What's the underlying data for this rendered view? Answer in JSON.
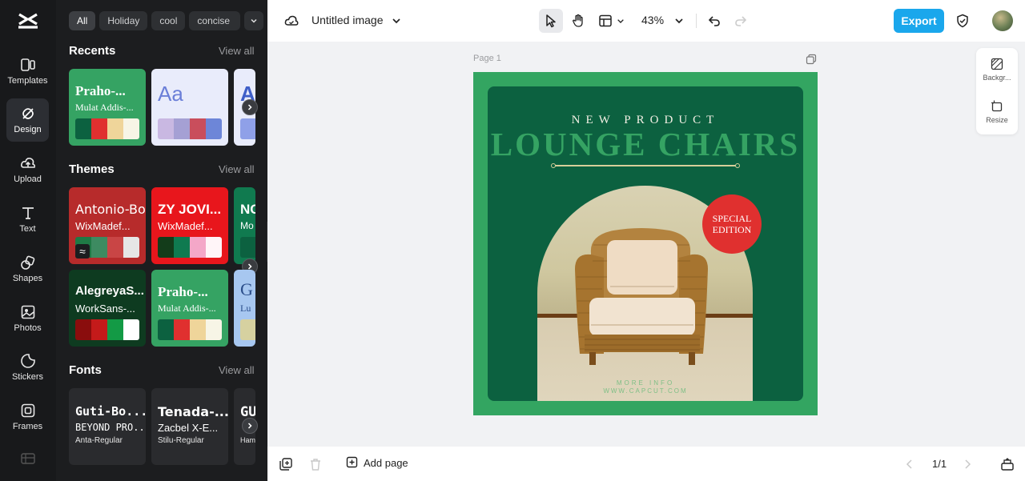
{
  "rail": {
    "items": [
      {
        "label": "Templates",
        "icon": "templates-icon"
      },
      {
        "label": "Design",
        "icon": "design-icon",
        "active": true
      },
      {
        "label": "Upload",
        "icon": "upload-icon"
      },
      {
        "label": "Text",
        "icon": "text-icon"
      },
      {
        "label": "Shapes",
        "icon": "shapes-icon"
      },
      {
        "label": "Photos",
        "icon": "photos-icon"
      },
      {
        "label": "Stickers",
        "icon": "stickers-icon"
      },
      {
        "label": "Frames",
        "icon": "frames-icon"
      }
    ]
  },
  "panel": {
    "chips": [
      "All",
      "Holiday",
      "cool",
      "concise"
    ],
    "recents": {
      "title": "Recents",
      "view_all": "View all",
      "cards": [
        {
          "t1": "Praho-...",
          "t2": "Mulat Addis-...",
          "bg": "#35a363",
          "fg": "#ffffff",
          "colors": [
            "#0c6140",
            "#e0302f",
            "#efd59a",
            "#f7f5e6"
          ]
        },
        {
          "t1": "Aa",
          "t2": "",
          "bg": "#e9ecfb",
          "fg": "#6b7fd8",
          "colors": [
            "#c9b8e2",
            "#a5a0d4",
            "#c94e5c",
            "#6d86d8"
          ]
        },
        {
          "t1": "A",
          "t2": "",
          "bg": "#e9ecfb",
          "fg": "#3f5fc8",
          "colors": [
            "#8fa0e8"
          ]
        }
      ]
    },
    "themes": {
      "title": "Themes",
      "view_all": "View all",
      "cards": [
        {
          "t1": "Antonio-Bold",
          "t2": "WixMadef...",
          "bg": "#b72b2b",
          "fg": "#ffffff",
          "colors": [
            "#1f7a45",
            "#3d8b61",
            "#c94545",
            "#e6e6e6"
          ]
        },
        {
          "t1": "ZY JOVI...",
          "t2": "WixMadef...",
          "bg": "#e8161c",
          "fg": "#ffffff",
          "colors": [
            "#133c1a",
            "#0f7a50",
            "#f4a7c8",
            "#fff5f8"
          ]
        },
        {
          "t1": "NC",
          "t2": "Mo",
          "bg": "#107a4f",
          "fg": "#ffffff",
          "colors": [
            "#0c6140"
          ]
        },
        {
          "t1": "AlegreyaS...",
          "t2": "WorkSans-...",
          "bg": "#0e3b20",
          "fg": "#ffffff",
          "colors": [
            "#8a0d0d",
            "#c41a1a",
            "#139a45",
            "#ffffff"
          ]
        },
        {
          "t1": "Praho-...",
          "t2": "Mulat Addis-...",
          "bg": "#35a363",
          "fg": "#ffffff",
          "colors": [
            "#0c6140",
            "#e0302f",
            "#efd59a",
            "#f7f5e6"
          ]
        },
        {
          "t1": "G",
          "t2": "Lu",
          "bg": "#a7c7f0",
          "fg": "#2a4d8a",
          "colors": [
            "#d6d1a0"
          ]
        }
      ]
    },
    "fonts": {
      "title": "Fonts",
      "view_all": "View all",
      "cards": [
        {
          "f1": "Guti-Bo...",
          "f2": "BEYOND PRO...",
          "f3": "Anta-Regular"
        },
        {
          "f1": "Tenada-...",
          "f2": "Zacbel X-E...",
          "f3": "Stilu-Regular"
        },
        {
          "f1": "GU",
          "f2": "",
          "f3": "Ham"
        }
      ]
    }
  },
  "topbar": {
    "title": "Untitled image",
    "zoom": "43%",
    "export_label": "Export",
    "tools": [
      "cloud-icon",
      "chevron-down-icon",
      "select-pointer-icon",
      "hand-icon",
      "layout-icon",
      "undo-icon",
      "redo-icon",
      "shield-icon"
    ]
  },
  "canvas": {
    "page_label": "Page 1",
    "design": {
      "headline_small": "NEW PRODUCT",
      "headline_large": "LOUNGE CHAIRS",
      "badge_line1": "SPECIAL",
      "badge_line2": "EDITION",
      "more_info": "MORE INFO",
      "website": "WWW.CAPCUT.COM",
      "colors": {
        "outer": "#33a561",
        "inner": "#0c6140",
        "accent": "#e0302f"
      }
    },
    "right_tools": [
      {
        "label": "Backgr...",
        "icon": "background-icon"
      },
      {
        "label": "Resize",
        "icon": "resize-icon"
      }
    ]
  },
  "bottombar": {
    "add_page_label": "Add page",
    "pager": "1/1"
  }
}
